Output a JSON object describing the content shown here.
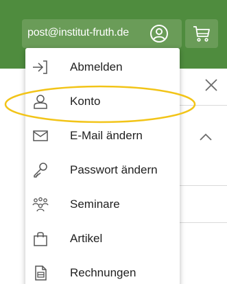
{
  "header": {
    "account_email": "post@institut-fruth.de",
    "user_icon": "user-circle-icon",
    "cart_icon": "shopping-cart-icon"
  },
  "account_menu": {
    "items": [
      {
        "label": "Abmelden",
        "icon": "logout-arrow-icon"
      },
      {
        "label": "Konto",
        "icon": "user-icon"
      },
      {
        "label": "E-Mail ändern",
        "icon": "envelope-icon"
      },
      {
        "label": "Passwort ändern",
        "icon": "key-icon"
      },
      {
        "label": "Seminare",
        "icon": "group-icon"
      },
      {
        "label": "Artikel",
        "icon": "shopping-bag-icon"
      },
      {
        "label": "Rechnungen",
        "icon": "invoice-icon"
      }
    ],
    "highlighted_item": "Konto"
  },
  "colors": {
    "header_green": "#4f8c3e",
    "button_green": "#6a9c58",
    "highlight_yellow": "#f2c418"
  }
}
